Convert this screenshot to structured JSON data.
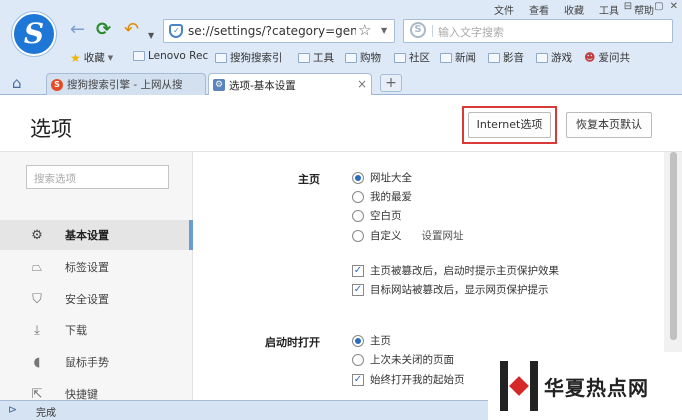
{
  "browser": {
    "menu": [
      "文件",
      "查看",
      "收藏",
      "工具",
      "帮助"
    ],
    "window_controls": [
      "⊟",
      "—",
      "▢",
      "✕"
    ],
    "address": "se://settings/?category=gen",
    "search_placeholder": "输入文字搜索",
    "logo_letter": "S"
  },
  "bookmarks": {
    "favorites_label": "收藏",
    "items": [
      "Lenovo Rec",
      "搜狗搜索引",
      "工具",
      "购物",
      "社区",
      "新闻",
      "影音",
      "游戏",
      "爱问共"
    ]
  },
  "tabs": [
    {
      "label": "搜狗搜索引擎 - 上网从搜",
      "active": false
    },
    {
      "label": "选项-基本设置",
      "active": true
    }
  ],
  "page": {
    "title": "选项",
    "internet_options_label": "Internet选项",
    "restore_label": "恢复本页默认"
  },
  "sidebar": {
    "search_placeholder": "搜索选项",
    "items": [
      {
        "label": "基本设置",
        "icon": "gear-icon",
        "active": true
      },
      {
        "label": "标签设置",
        "icon": "tab-icon",
        "active": false
      },
      {
        "label": "安全设置",
        "icon": "shield-icon",
        "active": false
      },
      {
        "label": "下载",
        "icon": "download-icon",
        "active": false
      },
      {
        "label": "鼠标手势",
        "icon": "mouse-icon",
        "active": false
      },
      {
        "label": "快捷键",
        "icon": "shortcut-icon",
        "active": false
      }
    ]
  },
  "homepage": {
    "label": "主页",
    "options": [
      "网址大全",
      "我的最爱",
      "空白页",
      "自定义"
    ],
    "selected_index": 0,
    "set_url_label": "设置网址",
    "checks": [
      {
        "label": "主页被篡改后，启动时提示主页保护效果",
        "checked": true
      },
      {
        "label": "目标网站被篡改后，显示网页保护提示",
        "checked": true
      }
    ]
  },
  "startup": {
    "label": "启动时打开",
    "options": [
      "主页",
      "上次未关闭的页面"
    ],
    "selected_index": 0,
    "checks": [
      {
        "label": "始终打开我的起始页",
        "checked": true
      }
    ]
  },
  "status": {
    "text": "完成"
  },
  "watermark": {
    "text": "华夏热点网"
  },
  "colors": {
    "highlight": "#d83a3a",
    "accent": "#2b6bbf",
    "chrome": "#dde9f7"
  }
}
